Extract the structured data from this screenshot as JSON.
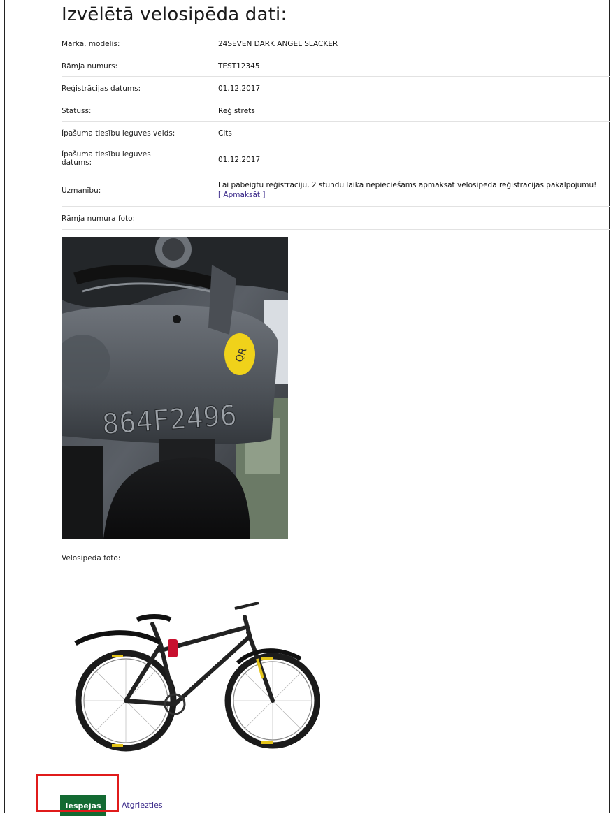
{
  "page": {
    "title": "Izvēlētā velosipēda dati:"
  },
  "details": [
    {
      "label": "Marka, modelis:",
      "value": "24SEVEN DARK ANGEL SLACKER"
    },
    {
      "label": "Rāmja numurs:",
      "value": "TEST12345"
    },
    {
      "label": "Reģistrācijas datums:",
      "value": "01.12.2017"
    },
    {
      "label": "Statuss:",
      "value": "Reģistrēts"
    },
    {
      "label": "Īpašuma tiesību ieguves veids:",
      "value": "Cits"
    },
    {
      "label": "Īpašuma tiesību ieguves datums:",
      "value": "01.12.2017"
    },
    {
      "label": "Uzmanību:",
      "value": "Lai pabeigtu reģistrāciju, 2 stundu laikā nepieciešams apmaksāt velosipēda reģistrācijas pakalpojumu!"
    }
  ],
  "pay_link": "[ Apmaksāt ]",
  "frame_photo": {
    "label": "Rāmja numura foto:",
    "stamped_number": "864F2496",
    "sticker_text": "QR"
  },
  "bike_photo": {
    "label": "Velosipēda foto:"
  },
  "actions": {
    "options_button": "Iespējas",
    "back_link": "Atgriezties"
  }
}
